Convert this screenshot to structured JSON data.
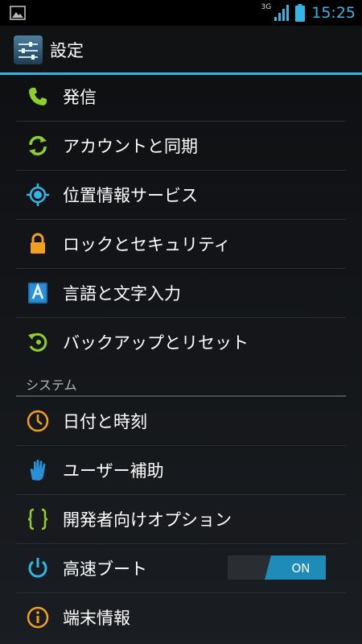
{
  "status_bar": {
    "network": "3G",
    "time": "15:25"
  },
  "action_bar": {
    "title": "設定",
    "icon": "settings-sliders-icon"
  },
  "items_top": [
    {
      "label": "発信",
      "icon": "phone-icon"
    },
    {
      "label": "アカウントと同期",
      "icon": "sync-icon"
    },
    {
      "label": "位置情報サービス",
      "icon": "location-icon"
    },
    {
      "label": "ロックとセキュリティ",
      "icon": "lock-icon"
    },
    {
      "label": "言語と文字入力",
      "icon": "keyboard-a-icon"
    },
    {
      "label": "バックアップとリセット",
      "icon": "backup-icon"
    }
  ],
  "section": {
    "label": "システム"
  },
  "items_system": [
    {
      "label": "日付と時刻",
      "icon": "clock-icon"
    },
    {
      "label": "ユーザー補助",
      "icon": "hand-icon"
    },
    {
      "label": "開発者向けオプション",
      "icon": "braces-icon"
    },
    {
      "label": "高速ブート",
      "icon": "power-icon",
      "toggle": "ON"
    },
    {
      "label": "端末情報",
      "icon": "info-icon"
    }
  ],
  "colors": {
    "accent": "#33b5e5",
    "toggle_on": "#1e8bb8"
  }
}
